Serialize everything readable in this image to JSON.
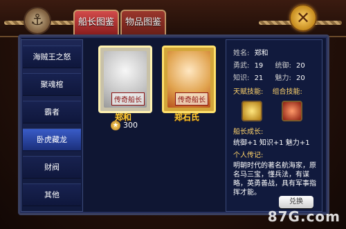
{
  "tabs": [
    {
      "label": "船长图鉴"
    },
    {
      "label": "物品图鉴"
    }
  ],
  "sidebar": {
    "items": [
      {
        "label": "海贼王之怒"
      },
      {
        "label": "聚魂棺"
      },
      {
        "label": "霸者"
      },
      {
        "label": "卧虎藏龙"
      },
      {
        "label": "财阀"
      },
      {
        "label": "其他"
      }
    ]
  },
  "captains": [
    {
      "name": "郑和",
      "stamp": "传奇船长",
      "medal_value": "300"
    },
    {
      "name": "郑石氏",
      "stamp": "传奇船长"
    }
  ],
  "detail": {
    "name_label": "姓名:",
    "name_value": "郑和",
    "brave_label": "勇武:",
    "brave_value": "19",
    "command_label": "统御:",
    "command_value": "20",
    "knowledge_label": "知识:",
    "knowledge_value": "21",
    "charm_label": "魅力:",
    "charm_value": "20",
    "talent_label": "天赋技能:",
    "combo_label": "组合技能:",
    "growth_label": "船长成长:",
    "growth_value": "统御+1 知识+1 魅力+1",
    "bio_label": "个人传记:",
    "bio_text": "明朝时代的著名航海家，原名马三宝，懂兵法，有谋略，英勇善战，具有军事指挥才能。",
    "button_label": "兑换"
  },
  "watermark": "87G.com",
  "colors": {
    "accent_red": "#d24b4b",
    "gold": "#ffcc33",
    "panel": "#111a3d"
  }
}
